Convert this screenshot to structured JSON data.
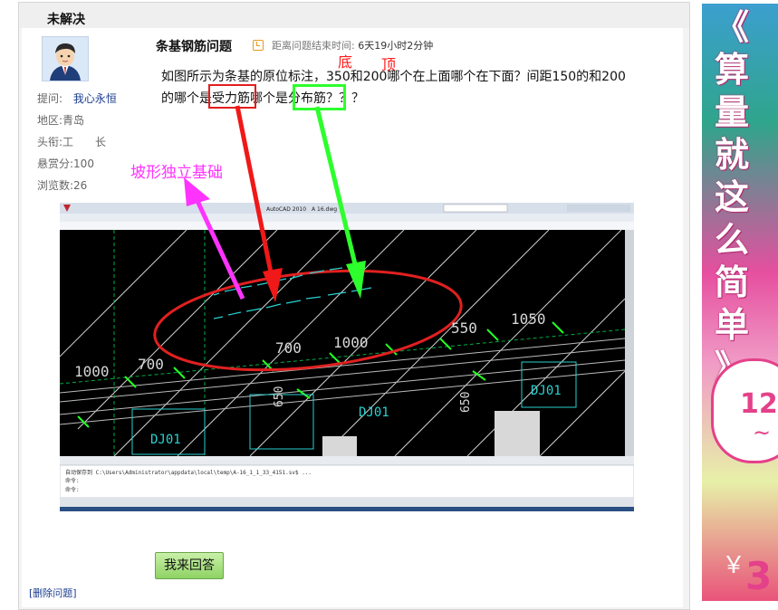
{
  "panel": {
    "title": "未解决"
  },
  "asker": {
    "label_asker": "提问:",
    "name": "我心永恒",
    "label_region": "地区:",
    "region": "青岛",
    "label_rank": "头衔:",
    "rank": "工　　长",
    "label_reward": "悬赏分:",
    "reward": "100",
    "label_views": "浏览数:",
    "views": "26"
  },
  "question": {
    "title": "条基钢筋问题",
    "deadline_label": "距离问题结束时间:",
    "deadline_value": "6天19小时2分钟",
    "note_bottom": "底",
    "note_top": "顶",
    "line1": "如图所示为条基的原位标注，350和200哪个在上面哪个在下面？间距150的和200",
    "line2_a": "的哪个是",
    "line2_b": "受力筋",
    "line2_c": "哪个是",
    "line2_d": "分布筋",
    "line2_e": "？？？",
    "annotation": "坡形独立基础"
  },
  "cad": {
    "app_title": "AutoCAD 2010",
    "file_name": "A 16.dwg",
    "cmd_line1": "自动保存到 C:\\Users\\Administrator\\appdata\\local\\temp\\A-16_1_1_33_4151.sv$ ...",
    "cmd_line2": "命令:",
    "cmd_line3": "命令:",
    "labels": [
      "1000",
      "700",
      "700",
      "1000",
      "550",
      "1050",
      "DJ01",
      "DJ01",
      "DJ01",
      "650",
      "650"
    ]
  },
  "actions": {
    "answer_button": "我来回答",
    "delete_link": "[删除问题]"
  },
  "banner": {
    "text": "《算量就这么简单》",
    "num": "12",
    "tilde": "~",
    "yen": "￥",
    "big": "3"
  },
  "colors": {
    "red": "#ff1a1a",
    "green": "#2dff2d",
    "magenta": "#ff33ff",
    "button_green": "#8fd264"
  }
}
